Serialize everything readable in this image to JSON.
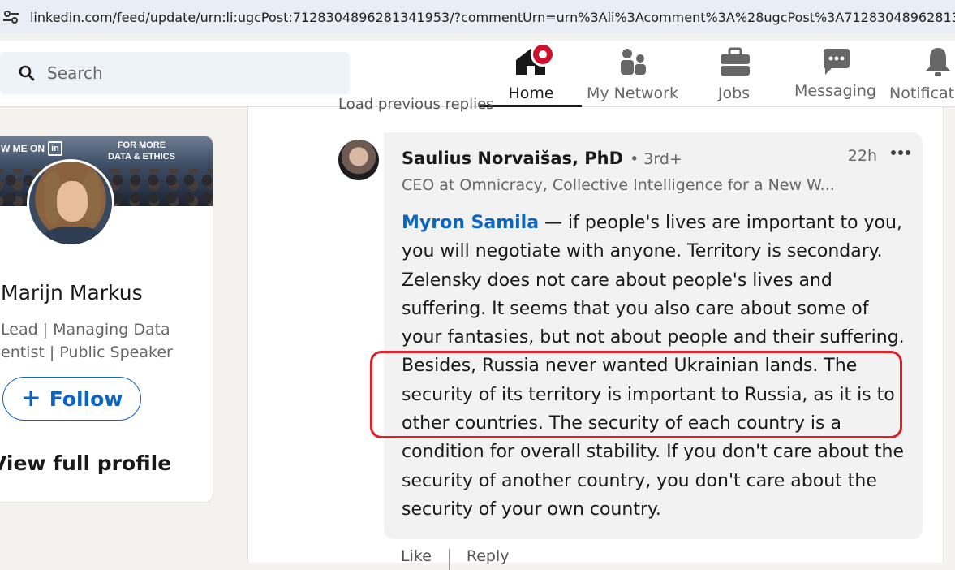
{
  "browser": {
    "url": "linkedin.com/feed/update/urn:li:ugcPost:7128304896281341953/?commentUrn=urn%3Ali%3Acomment%3A%28ugcPost%3A712830489628134195"
  },
  "nav": {
    "search_placeholder": "Search",
    "items": [
      {
        "label": "Home",
        "icon": "home-icon"
      },
      {
        "label": "My Network",
        "icon": "network-icon"
      },
      {
        "label": "Jobs",
        "icon": "briefcase-icon"
      },
      {
        "label": "Messaging",
        "icon": "message-icon"
      },
      {
        "label": "Notificat",
        "icon": "bell-icon"
      }
    ]
  },
  "profile": {
    "banner_left": "W ME ON",
    "banner_in": "in",
    "banner_right_line1": "FOR MORE",
    "banner_right_line2": "DATA & ETHICS",
    "name": "Marijn Markus",
    "headline_line1": "Lead | Managing Data",
    "headline_line2": "entist | Public Speaker",
    "follow_label": "Follow",
    "view_profile": "View full profile"
  },
  "feed": {
    "load_previous": "Load previous replies",
    "comment": {
      "author": "Saulius Norvaišas, PhD",
      "degree": "• 3rd+",
      "time": "22h",
      "headline": "CEO at Omnicracy, Collective Intelligence for a New W...",
      "mention": "Myron Samila",
      "text": " — if people's lives are important to you, you will negotiate with anyone. Territory is secondary. Zelensky does not care about people's lives and suffering. It seems that you also care about some of your fantasies, but not about people and their suffering. Besides, Russia never wanted Ukrainian lands. The security of its territory is important to Russia, as it is to other countries. The security of each country is a condition for overall stability. If you don't care about the security of another country, you don't care about the security of your own country."
    },
    "actions": {
      "like": "Like",
      "reply": "Reply"
    }
  },
  "colors": {
    "linkedin_blue": "#0a66c2",
    "notification_red": "#cb112d",
    "highlight_red": "#dd1f26"
  }
}
